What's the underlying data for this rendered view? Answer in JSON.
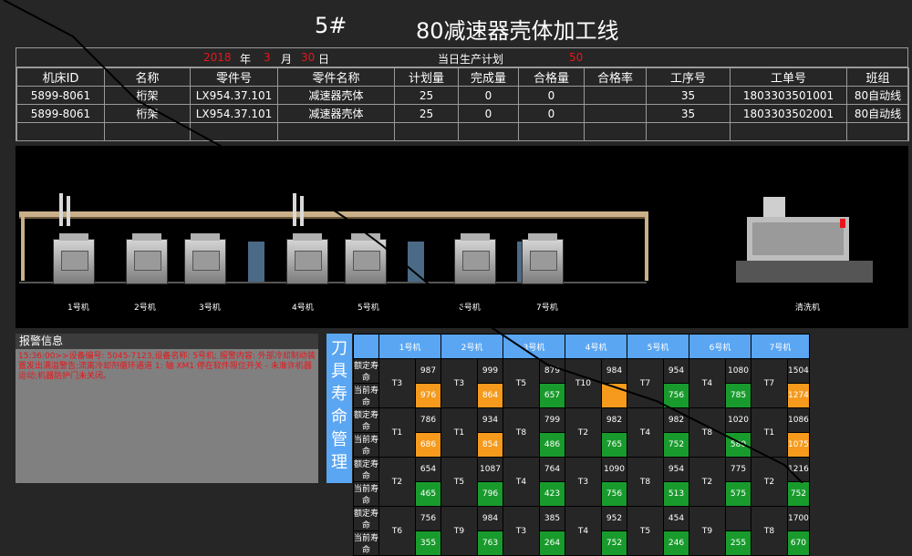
{
  "title": {
    "line_no": "5#",
    "line_name": "80减速器壳体加工线"
  },
  "date": {
    "year": "2018",
    "year_unit": "年",
    "month": "3",
    "month_unit": "月",
    "day": "30",
    "day_unit": "日",
    "plan_label": "当日生产计划",
    "plan_value": "50"
  },
  "table": {
    "headers": [
      "机床ID",
      "名称",
      "零件号",
      "零件名称",
      "计划量",
      "完成量",
      "合格量",
      "合格率",
      "工序号",
      "工单号",
      "班组"
    ],
    "rows": [
      [
        "5899-8061",
        "桁架",
        "LX954.37.101",
        "减速器壳体",
        "25",
        "0",
        "0",
        "",
        "35",
        "1803303501001",
        "80自动线"
      ],
      [
        "5899-8061",
        "桁架",
        "LX954.37.101",
        "减速器壳体",
        "25",
        "0",
        "0",
        "",
        "35",
        "1803303502001",
        "80自动线"
      ]
    ]
  },
  "machines": [
    "1号机",
    "2号机",
    "3号机",
    "4号机",
    "5号机",
    "6号机",
    "7号机",
    "清洗机"
  ],
  "alarm": {
    "header": "报警信息",
    "text": "15:36:00>>设备编号: 5045-7123,设备名称: 5号机; 报警内容: 外部冷却制动装置发出满溢警告;流离冷却剂循环通道 1: 轴 XM1 停在软件限位开关 - 未准许机器运动;机器防护门未关闭。"
  },
  "tool": {
    "vertical_title": [
      "刀",
      "具",
      "寿",
      "命",
      "管",
      "理"
    ],
    "columns": [
      "1号机",
      "2号机",
      "3号机",
      "4号机",
      "5号机",
      "6号机",
      "7号机"
    ],
    "rated_label": "额定寿命",
    "current_label": "当前寿命",
    "groups": [
      {
        "tools": [
          "T3",
          "T3",
          "T5",
          "T10",
          "T7",
          "T4",
          "T7"
        ],
        "rated": [
          "987",
          "999",
          "879",
          "984",
          "954",
          "1080",
          "1504"
        ],
        "current": [
          "976",
          "864",
          "657",
          "",
          "756",
          "785",
          "1274"
        ],
        "current_color": [
          "org",
          "org",
          "grn",
          "org",
          "grn",
          "grn",
          "org"
        ]
      },
      {
        "tools": [
          "T1",
          "T1",
          "T8",
          "T2",
          "T4",
          "T8",
          "T1"
        ],
        "rated": [
          "786",
          "934",
          "799",
          "982",
          "982",
          "1020",
          "1086"
        ],
        "current": [
          "686",
          "854",
          "486",
          "765",
          "752",
          "580",
          "1075"
        ],
        "current_color": [
          "org",
          "org",
          "grn",
          "grn",
          "grn",
          "grn",
          "org"
        ]
      },
      {
        "tools": [
          "T2",
          "T5",
          "T4",
          "T3",
          "T8",
          "T2",
          "T2"
        ],
        "rated": [
          "654",
          "1087",
          "764",
          "1090",
          "954",
          "775",
          "1216"
        ],
        "current": [
          "465",
          "796",
          "423",
          "756",
          "513",
          "575",
          "752"
        ],
        "current_color": [
          "grn",
          "grn",
          "grn",
          "grn",
          "grn",
          "grn",
          "grn"
        ]
      },
      {
        "tools": [
          "T6",
          "T9",
          "T3",
          "T4",
          "T5",
          "T9",
          "T8"
        ],
        "rated": [
          "756",
          "984",
          "385",
          "952",
          "454",
          "",
          "1700"
        ],
        "current": [
          "355",
          "763",
          "264",
          "752",
          "246",
          "255",
          "670"
        ],
        "current_color": [
          "grn",
          "grn",
          "grn",
          "grn",
          "grn",
          "grn",
          "grn"
        ]
      }
    ]
  },
  "colors": {
    "accent_blue": "#5aa6f3",
    "alarm_red": "#e8161b",
    "life_ok": "#189b2c",
    "life_warn": "#f59a1c"
  }
}
